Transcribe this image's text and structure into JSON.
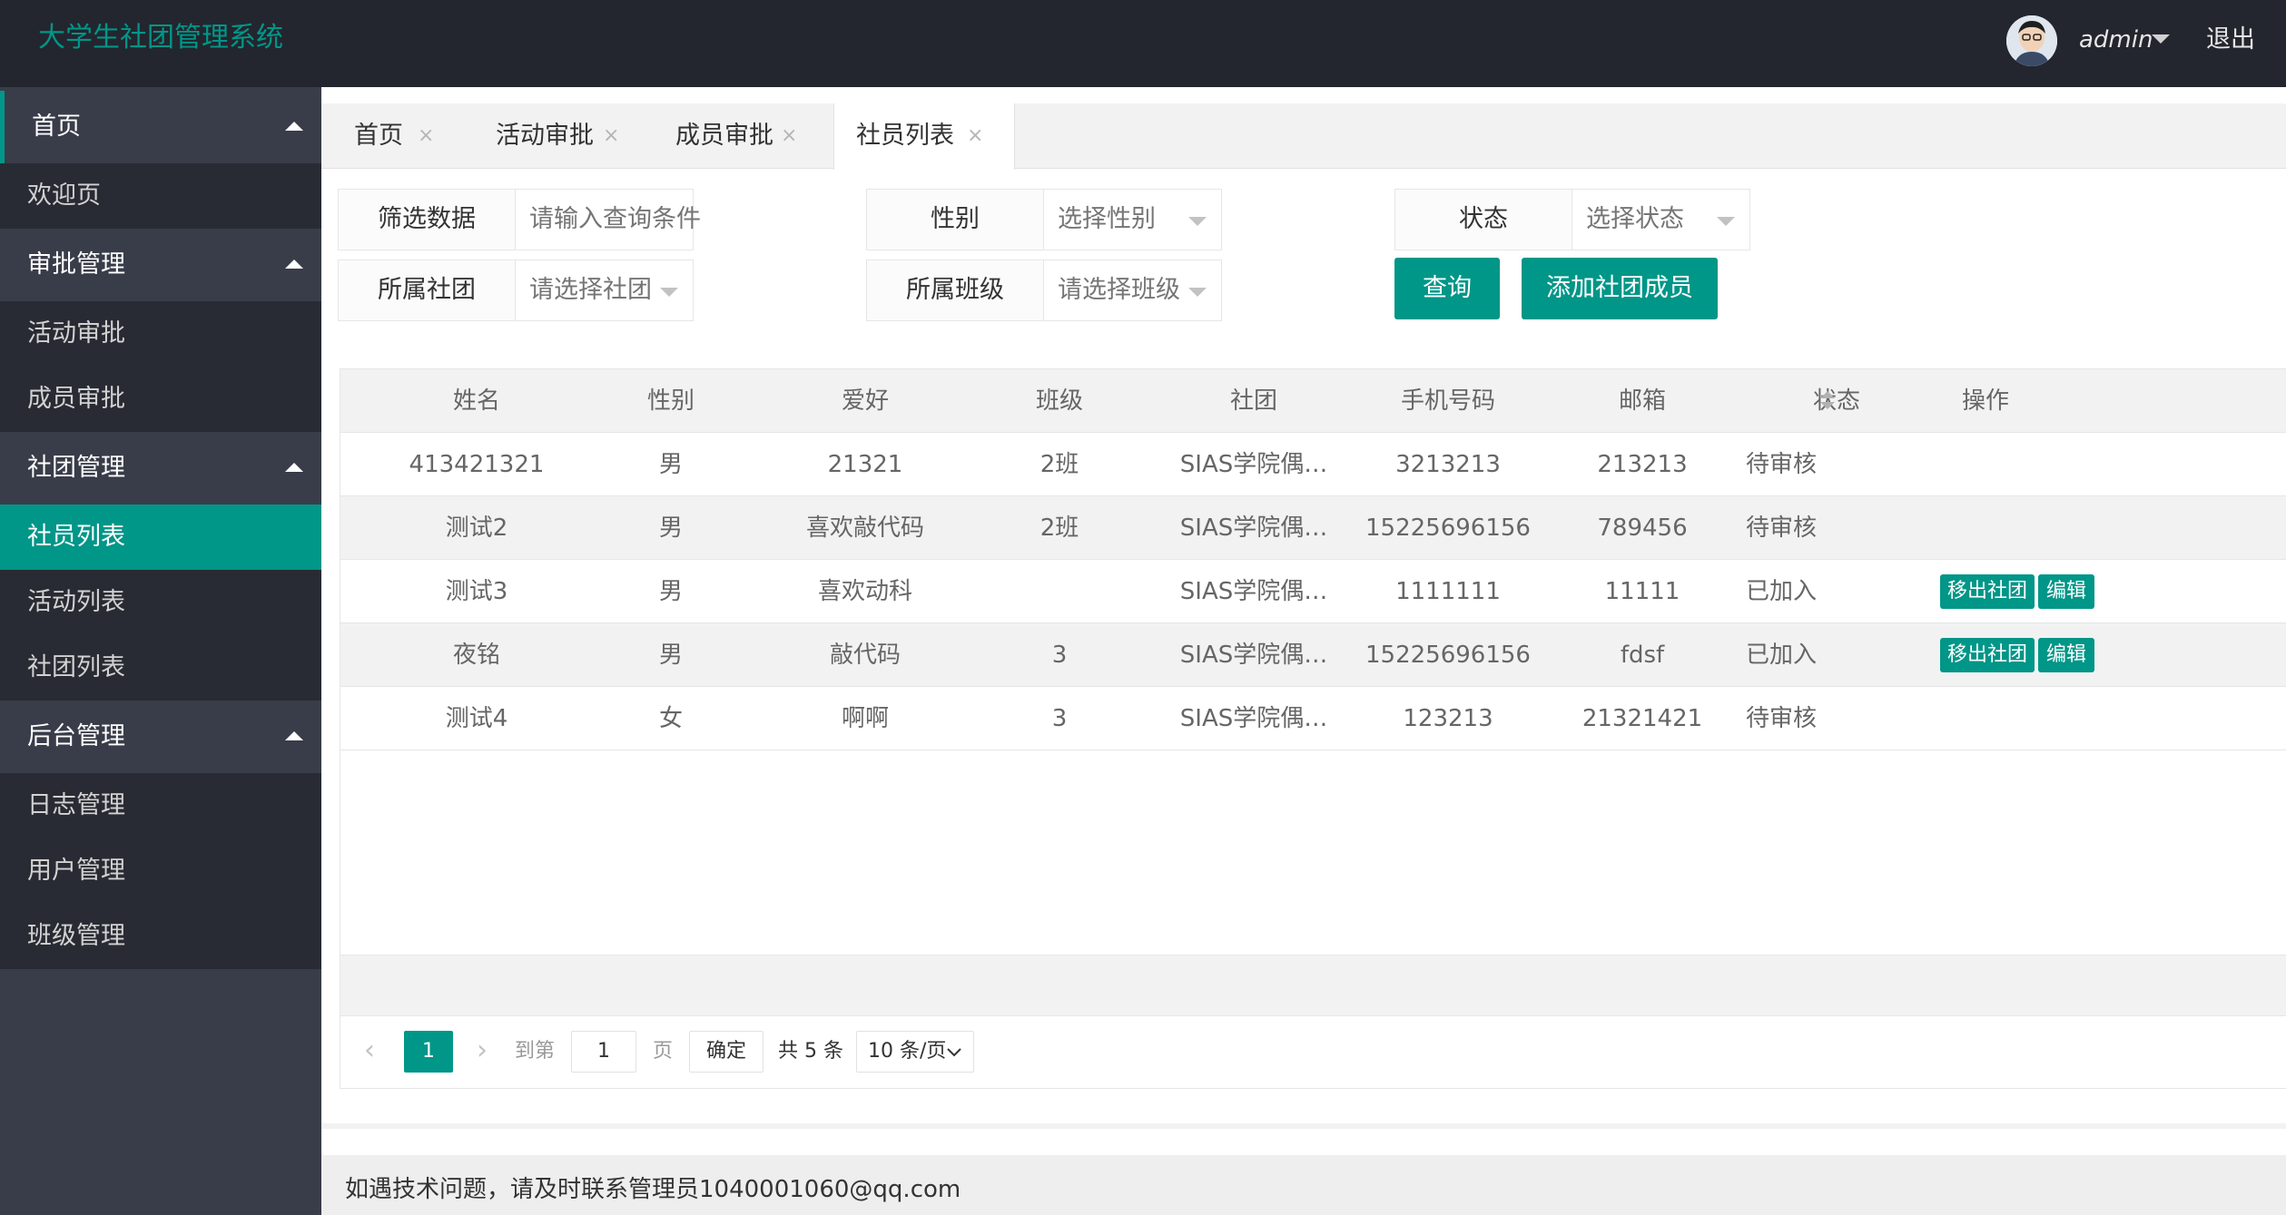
{
  "header": {
    "logo": "大学生社团管理系统",
    "user": "admin",
    "logout": "退出"
  },
  "sidebar": {
    "groups": [
      {
        "label": "首页",
        "items": [
          {
            "label": "欢迎页"
          }
        ]
      },
      {
        "label": "审批管理",
        "items": [
          {
            "label": "活动审批"
          },
          {
            "label": "成员审批"
          }
        ]
      },
      {
        "label": "社团管理",
        "items": [
          {
            "label": "社员列表",
            "selected": true
          },
          {
            "label": "活动列表"
          },
          {
            "label": "社团列表"
          }
        ]
      },
      {
        "label": "后台管理",
        "items": [
          {
            "label": "日志管理"
          },
          {
            "label": "用户管理"
          },
          {
            "label": "班级管理"
          }
        ]
      }
    ]
  },
  "tabs": [
    {
      "label": "首页",
      "close": "×"
    },
    {
      "label": "活动审批",
      "close": "×"
    },
    {
      "label": "成员审批",
      "close": "×"
    },
    {
      "label": "社员列表",
      "close": "×",
      "active": true
    }
  ],
  "filters": {
    "keyword": {
      "label": "筛选数据",
      "placeholder": "请输入查询条件"
    },
    "gender": {
      "label": "性别",
      "placeholder": "选择性别"
    },
    "status": {
      "label": "状态",
      "placeholder": "选择状态"
    },
    "club": {
      "label": "所属社团",
      "placeholder": "请选择社团"
    },
    "class": {
      "label": "所属班级",
      "placeholder": "请选择班级"
    },
    "query_button": "查询",
    "add_button": "添加社团成员"
  },
  "table": {
    "columns": [
      "姓名",
      "性别",
      "爱好",
      "班级",
      "社团",
      "手机号码",
      "邮箱",
      "状态",
      "操作"
    ],
    "rows": [
      {
        "name": "413421321",
        "gender": "男",
        "hobby": "21321",
        "class": "2班",
        "club": "SIAS学院偶…",
        "phone": "3213213",
        "email": "213213",
        "status": "待审核"
      },
      {
        "name": "测试2",
        "gender": "男",
        "hobby": "喜欢敲代码",
        "class": "2班",
        "club": "SIAS学院偶…",
        "phone": "15225696156",
        "email": "789456",
        "status": "待审核"
      },
      {
        "name": "测试3",
        "gender": "男",
        "hobby": "喜欢动科",
        "class": "",
        "club": "SIAS学院偶…",
        "phone": "1111111",
        "email": "11111",
        "status": "已加入",
        "actions": [
          "移出社团",
          "编辑"
        ]
      },
      {
        "name": "夜铭",
        "gender": "男",
        "hobby": "敲代码",
        "class": "3",
        "club": "SIAS学院偶…",
        "phone": "15225696156",
        "email": "fdsf",
        "status": "已加入",
        "actions": [
          "移出社团",
          "编辑"
        ]
      },
      {
        "name": "测试4",
        "gender": "女",
        "hobby": "啊啊",
        "class": "3",
        "club": "SIAS学院偶…",
        "phone": "123213",
        "email": "21321421",
        "status": "待审核"
      }
    ]
  },
  "pagination": {
    "prev": "‹",
    "next": "›",
    "current": "1",
    "goto_label": "到第",
    "goto_value": "1",
    "page_label": "页",
    "confirm": "确定",
    "total": "共 5 条",
    "page_size": "10 条/页"
  },
  "footer": {
    "text": "如遇技术问题，请及时联系管理员1040001060@qq.com"
  },
  "colors": {
    "accent": "#009688",
    "header_bg": "#23262e",
    "sidebar_bg": "#393d49",
    "sidebar_item_bg": "#282b33"
  }
}
